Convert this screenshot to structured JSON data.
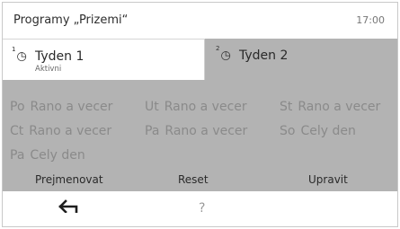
{
  "header": {
    "title": "Programy „Prizemi“",
    "clock": "17:00"
  },
  "tabs": [
    {
      "label": "Tyden 1",
      "sub": "Aktivni",
      "icon": "clock-icon",
      "badge": "1"
    },
    {
      "label": "Tyden 2",
      "icon": "clock-icon",
      "badge": "2"
    }
  ],
  "schedule": [
    {
      "day": "Po",
      "value": "Rano a vecer"
    },
    {
      "day": "Ut",
      "value": "Rano a vecer"
    },
    {
      "day": "St",
      "value": "Rano a vecer"
    },
    {
      "day": "Ct",
      "value": "Rano a vecer"
    },
    {
      "day": "Pa",
      "value": "Rano a vecer"
    },
    {
      "day": "So",
      "value": "Cely den"
    },
    {
      "day": "Pa",
      "value": "Cely den"
    }
  ],
  "actions": {
    "rename": "Prejmenovat",
    "reset": "Reset",
    "edit": "Upravit"
  },
  "bottom": {
    "back_icon": "back-arrow-icon",
    "help": "?"
  },
  "colors": {
    "panel": "#b3b3b3",
    "inactive_text": "#8a8a8a"
  }
}
